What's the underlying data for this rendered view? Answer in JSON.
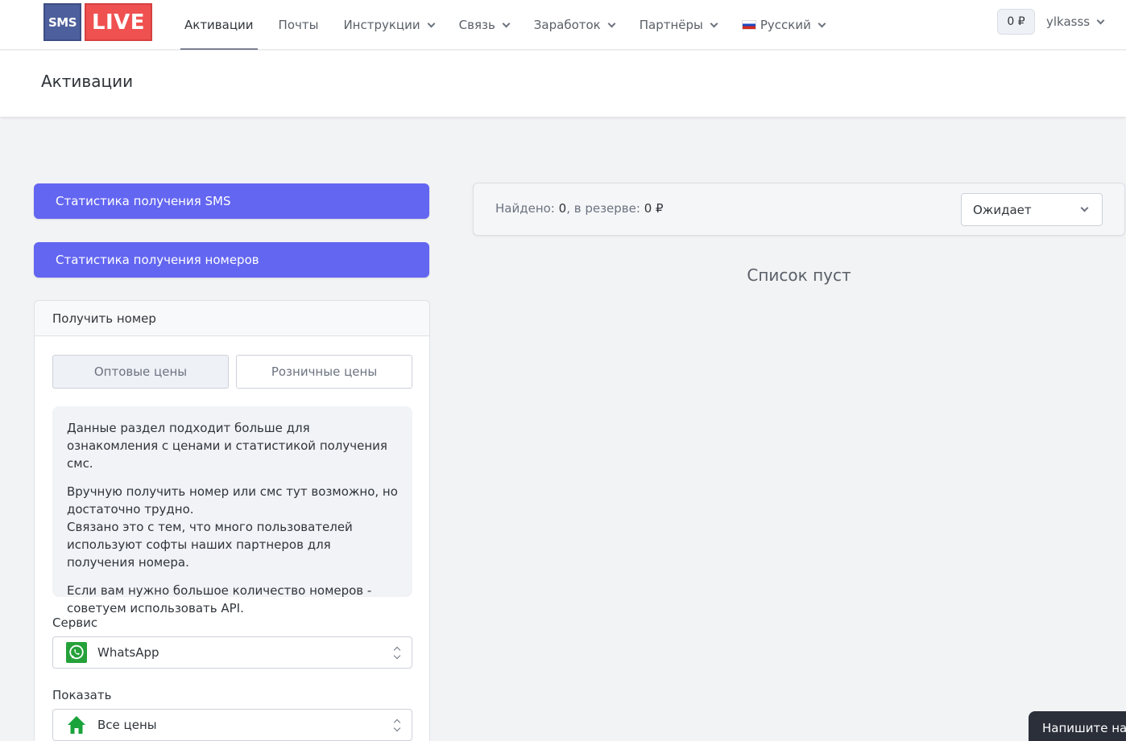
{
  "logo": {
    "sms": "SMS",
    "live": "LIVE"
  },
  "nav": {
    "items": [
      {
        "label": "Активации",
        "active": true,
        "dropdown": false
      },
      {
        "label": "Почты",
        "active": false,
        "dropdown": false
      },
      {
        "label": "Инструкции",
        "active": false,
        "dropdown": true
      },
      {
        "label": "Связь",
        "active": false,
        "dropdown": true
      },
      {
        "label": "Заработок",
        "active": false,
        "dropdown": true
      },
      {
        "label": "Партнёры",
        "active": false,
        "dropdown": true
      }
    ],
    "language": "Русский"
  },
  "header": {
    "balance": "0 ₽",
    "username": "ylkasss"
  },
  "page": {
    "title": "Активации"
  },
  "left": {
    "sms_stats_button": "Статистика получения SMS",
    "numbers_stats_button": "Статистика получения номеров",
    "get_number": {
      "title": "Получить номер",
      "tab_wholesale": "Оптовые цены",
      "tab_retail": "Розничные цены",
      "info_p1": "Данные раздел подходит больше для ознакомления с ценами и статистикой получения смс.",
      "info_p2a": "Вручную получить номер или смс тут возможно, но достаточно трудно.",
      "info_p2b": "Связано это с тем, что много пользователей используют софты наших партнеров для получения номера.",
      "info_p3": "Если вам нужно большое количество номеров - советуем использовать API.",
      "service_label": "Сервис",
      "service_value": "WhatsApp",
      "show_label": "Показать",
      "show_value": "Все цены"
    }
  },
  "right": {
    "found_label": "Найдено:",
    "found_count": "0",
    "reserve_label": ", в резерве:",
    "reserve_value": "0 ₽",
    "status_value": "Ожидает",
    "empty_text": "Список пуст"
  },
  "chat": {
    "label": "Напишите нам"
  },
  "colors": {
    "accent": "#6366f1",
    "whatsapp": "#25a13a",
    "home": "#1aa33a",
    "logo_blue": "#4d5f9c",
    "logo_red": "#ef5150"
  },
  "icons": [
    "whatsapp-icon",
    "home-icon",
    "russia-flag-icon",
    "chevron-down-icon"
  ]
}
